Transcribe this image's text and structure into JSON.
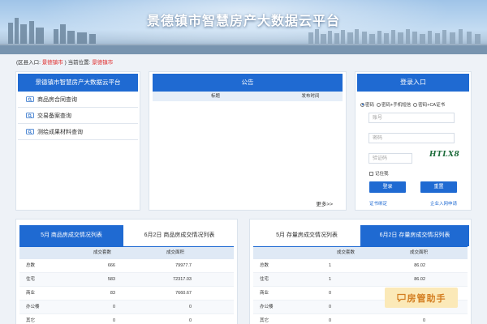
{
  "banner": {
    "title": "景德镇市智慧房产大数据云平台"
  },
  "location": {
    "area_label": "(区县入口:",
    "area_value": "景德镇市",
    "current_label": ")   当前位置:",
    "current_value": "景德镇市"
  },
  "sidebar": {
    "title": "景德镇市智慧房产大数据云平台",
    "items": [
      {
        "label": "商品房合同查询",
        "icon": "search-badge-icon"
      },
      {
        "label": "交易备案查询",
        "icon": "search-badge-icon"
      },
      {
        "label": "测绘成果材料查询",
        "icon": "search-badge-icon"
      }
    ]
  },
  "notice": {
    "title": "公告",
    "columns": [
      "标题",
      "发布时间"
    ],
    "more_label": "更多>>"
  },
  "login": {
    "title": "登录入口",
    "modes": [
      {
        "label": "密码",
        "selected": true
      },
      {
        "label": "密码+手机短信",
        "selected": false
      },
      {
        "label": "密码+CA证书",
        "selected": false
      }
    ],
    "account_placeholder": "账号",
    "password_placeholder": "密码",
    "captcha_placeholder": "验证码",
    "captcha_text": "HTLX8",
    "remember_label": "记住我",
    "login_button": "登录",
    "reset_button": "重置",
    "cert_link": "证书绑定",
    "enterprise_link": "企业入网申请"
  },
  "stats_new": {
    "tabs": [
      "5月 商品房成交情况列表",
      "6月2日 商品房成交情况列表"
    ],
    "active_tab": 0,
    "columns": [
      "",
      "成交套数",
      "成交面积"
    ],
    "rows": [
      {
        "type": "总数",
        "count": "666",
        "area": "79977.7"
      },
      {
        "type": "住宅",
        "count": "583",
        "area": "72317.03"
      },
      {
        "type": "商业",
        "count": "83",
        "area": "7660.67"
      },
      {
        "type": "办公楼",
        "count": "0",
        "area": "0"
      },
      {
        "type": "其它",
        "count": "0",
        "area": "0"
      }
    ]
  },
  "stats_used": {
    "tabs": [
      "5月 存量房成交情况列表",
      "6月2日 存量房成交情况列表"
    ],
    "active_tab": 1,
    "columns": [
      "",
      "成交套数",
      "成交面积"
    ],
    "rows": [
      {
        "type": "总数",
        "count": "1",
        "area": "86.02"
      },
      {
        "type": "住宅",
        "count": "1",
        "area": "86.02"
      },
      {
        "type": "商业",
        "count": "0",
        "area": "0"
      },
      {
        "type": "办公楼",
        "count": "0",
        "area": "0"
      },
      {
        "type": "其它",
        "count": "0",
        "area": "0"
      }
    ]
  },
  "watermark": {
    "text": "房管助手",
    "icon": "chat-bubble-icon"
  },
  "colors": {
    "primary": "#1f6ad2",
    "location_highlight": "#e02b2b",
    "watermark": "#d37d20"
  }
}
